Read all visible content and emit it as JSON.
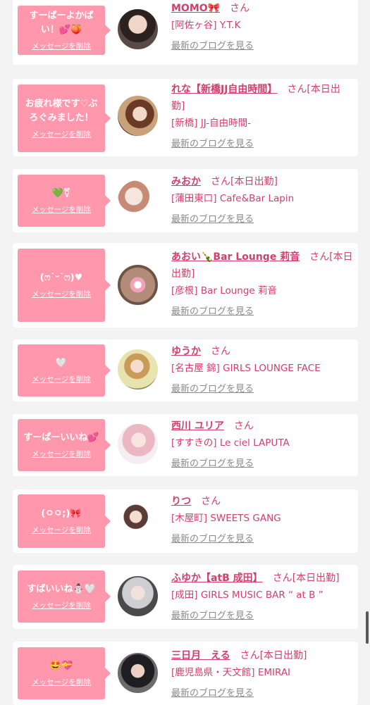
{
  "colors": {
    "bubble": "#ff97ad",
    "name": "#d23f6d",
    "blog_link": "#8a8a8a",
    "background": "#f3f3f3"
  },
  "delete_label": "メッセージを削除",
  "blog_label": "最新のブログを見る",
  "honorific": "さん",
  "entries": [
    {
      "message": "すーぱーよかばい！💕🍑",
      "name": "MOMO🎀",
      "status": "",
      "shop": "[阿佐ヶ谷] Y.T.K",
      "avatar": "avatar-photo-momo"
    },
    {
      "message": "お疲れ様です♡ぶろぐみました！",
      "name": "れな【新橋JJ自由時間】",
      "status": "[本日出勤]",
      "shop": "[新橋] JJ-自由時間-",
      "avatar": "avatar-photo-rena"
    },
    {
      "message": "💚⚧",
      "name": "みおか",
      "status": "[本日出勤]",
      "shop": "[蒲田東口] Cafe&Bar Lapin",
      "avatar": "avatar-photo-mioka"
    },
    {
      "message": "(ෆ˙ᵕ˙ෆ)♥",
      "name": "あおい🍾Bar Lounge 莉音",
      "status": "[本日出勤]",
      "shop": "[彦根] Bar Lounge 莉音",
      "avatar": "avatar-photo-aoi"
    },
    {
      "message": "🤍",
      "name": "ゆうか",
      "status": "",
      "shop": "[名古屋 錦] GIRLS LOUNGE FACE",
      "avatar": "avatar-photo-yuka"
    },
    {
      "message": "すーぱーいいね💕",
      "name": "西川 ユリア",
      "status": "",
      "shop": "[すすきの] Le ciel LAPUTA",
      "avatar": "avatar-photo-yuria"
    },
    {
      "message": "(ㅇㅇ;)🎀",
      "name": "りつ",
      "status": "",
      "shop": "[木屋町] SWEETS GANG",
      "avatar": "avatar-photo-ritsu"
    },
    {
      "message": "すばいいね⛄🤍",
      "name": "ふゆか【atB 成田】",
      "status": "[本日出勤]",
      "shop": "[成田] GIRLS MUSIC BAR “ at B ”",
      "avatar": "avatar-photo-fuyuka"
    },
    {
      "message": "🤩💝",
      "name": "三日月　える",
      "status": "[本日出勤]",
      "shop": "[鹿児島県・天文館] EMIRAI",
      "avatar": "avatar-photo-eru"
    }
  ]
}
